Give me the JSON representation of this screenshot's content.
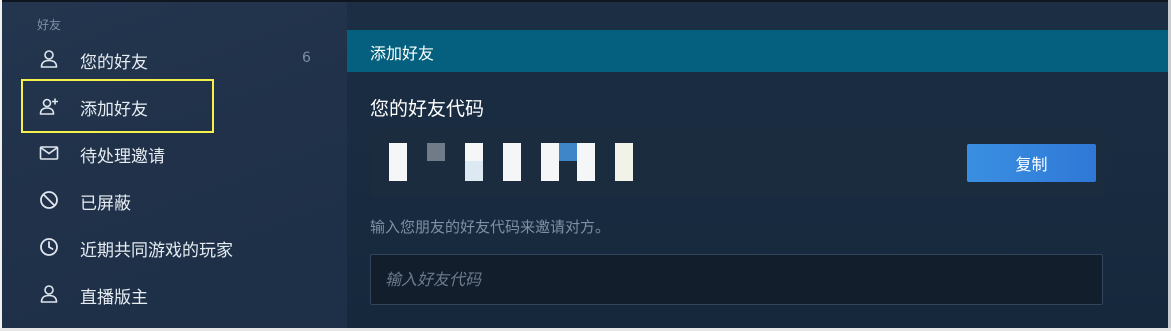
{
  "sidebar": {
    "section_title": "好友",
    "items": [
      {
        "label": "您的好友",
        "count": "6",
        "icon": "user-icon"
      },
      {
        "label": "添加好友",
        "icon": "add-user-icon"
      },
      {
        "label": "待处理邀请",
        "icon": "envelope-icon"
      },
      {
        "label": "已屏蔽",
        "icon": "block-icon"
      },
      {
        "label": "近期共同游戏的玩家",
        "icon": "clock-icon"
      },
      {
        "label": "直播版主",
        "icon": "user-icon"
      }
    ]
  },
  "main": {
    "header_title": "添加好友",
    "code_title": "您的好友代码",
    "copy_label": "复制",
    "instruction": "输入您朋友的好友代码来邀请对方。",
    "input_placeholder": "输入好友代码",
    "input_value": ""
  },
  "colors": {
    "accent": "#3a8fe2",
    "header_bar": "#04607e",
    "highlight": "#f5f04a"
  }
}
